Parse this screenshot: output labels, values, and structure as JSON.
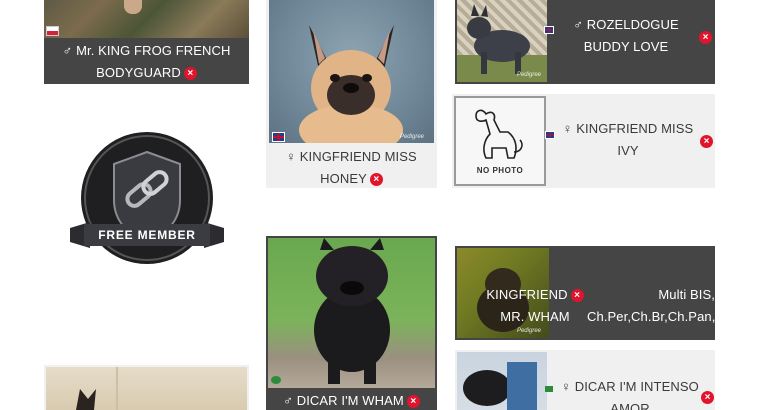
{
  "cards": {
    "king_frog": {
      "name_line1": "♂ Mr. KING FROG FRENCH",
      "name_line2": "BODYGUARD"
    },
    "honey": {
      "name_line1": "♀ KINGFRIEND MISS",
      "name_line2": "HONEY"
    },
    "buddy_love": {
      "name_line1": "♂ ROZELDOGUE",
      "name_line2": "BUDDY LOVE"
    },
    "ivy": {
      "name_line1": "♀ KINGFRIEND MISS",
      "name_line2": "IVY",
      "no_photo": "NO PHOTO"
    },
    "wham": {
      "name": "♂ DICAR I'M WHAM"
    },
    "mr_wham": {
      "name_line1": "KINGFRIEND",
      "name_line2": "MR. WHAM",
      "titles_line1": "Multi BIS,",
      "titles_line2": "Ch.Per,Ch.Br,Ch.Pan,("
    },
    "intenso": {
      "name_line1": "♀ DICAR I'M INTENSO",
      "name_line2": "AMOR"
    }
  },
  "badge": {
    "label": "FREE MEMBER"
  },
  "remove_symbol": "×",
  "colors": {
    "dark_card": "#454545",
    "light_card": "#f0f0f0",
    "remove_red": "#e0142c"
  }
}
